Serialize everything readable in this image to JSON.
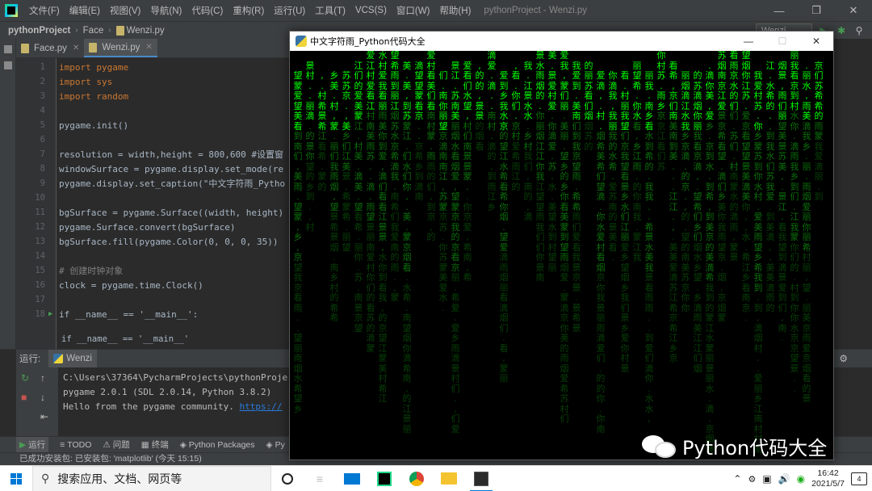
{
  "menubar": {
    "items": [
      "文件(F)",
      "编辑(E)",
      "视图(V)",
      "导航(N)",
      "代码(C)",
      "重构(R)",
      "运行(U)",
      "工具(T)",
      "VCS(S)",
      "窗口(W)",
      "帮助(H)"
    ],
    "title": "pythonProject - Wenzi.py"
  },
  "breadcrumb": {
    "project": "pythonProject",
    "folder": "Face",
    "file": "Wenzi.py"
  },
  "toolbar": {
    "run_config": "Wenzi"
  },
  "editor": {
    "tabs": [
      {
        "label": "Face.py"
      },
      {
        "label": "Wenzi.py"
      }
    ],
    "lines": [
      {
        "n": "1",
        "text": "import pygame"
      },
      {
        "n": "2",
        "text": "import sys"
      },
      {
        "n": "3",
        "text": "import random"
      },
      {
        "n": "4",
        "text": ""
      },
      {
        "n": "5",
        "text": "pygame.init()"
      },
      {
        "n": "6",
        "text": ""
      },
      {
        "n": "7",
        "text": "resolution = width,height = 800,600 #设置窗"
      },
      {
        "n": "8",
        "text": "windowSurface = pygame.display.set_mode(re"
      },
      {
        "n": "9",
        "text": "pygame.display.set_caption(\"中文字符雨_Pytho"
      },
      {
        "n": "10",
        "text": ""
      },
      {
        "n": "11",
        "text": "bgSurface = pygame.Surface((width, height)"
      },
      {
        "n": "12",
        "text": "pygame.Surface.convert(bgSurface)"
      },
      {
        "n": "13",
        "text": "bgSurface.fill(pygame.Color(0, 0, 0, 35))"
      },
      {
        "n": "14",
        "text": ""
      },
      {
        "n": "15",
        "text": "# 创建时钟对象"
      },
      {
        "n": "16",
        "text": "clock = pygame.time.Clock()"
      },
      {
        "n": "17",
        "text": ""
      },
      {
        "n": "18",
        "text": "if __name__ == '__main__':"
      }
    ],
    "hint": "if __name__ == '__main__'"
  },
  "run_panel": {
    "header_label": "运行:",
    "tab_label": "Wenzi",
    "console_lines": [
      "C:\\Users\\37364\\PycharmProjects\\pythonProje",
      "pygame 2.0.1 (SDL 2.0.14, Python 3.8.2)",
      "Hello from the pygame community. "
    ],
    "console_link": "https://"
  },
  "tool_strip": {
    "items": [
      "运行",
      "TODO",
      "问题",
      "终端",
      "Python Packages",
      "Py"
    ]
  },
  "status_bar": {
    "text": "已成功安装包: 已安装包: 'matplotlib' (今天 15:15)"
  },
  "pygame_window": {
    "title": "中文字符雨_Python代码大全",
    "charset": "我爱你南京江苏美丽的乡村水景烟雨蒙望希们到看滴",
    "colors": {
      "bright": "#00ff00",
      "dim": "#0b6e0b",
      "fade": "#073f07"
    }
  },
  "watermark": {
    "text": "Python代码大全"
  },
  "taskbar": {
    "search_placeholder": "搜索应用、文档、网页等",
    "time": "16:42",
    "date": "2021/5/7",
    "notif_count": "4"
  }
}
